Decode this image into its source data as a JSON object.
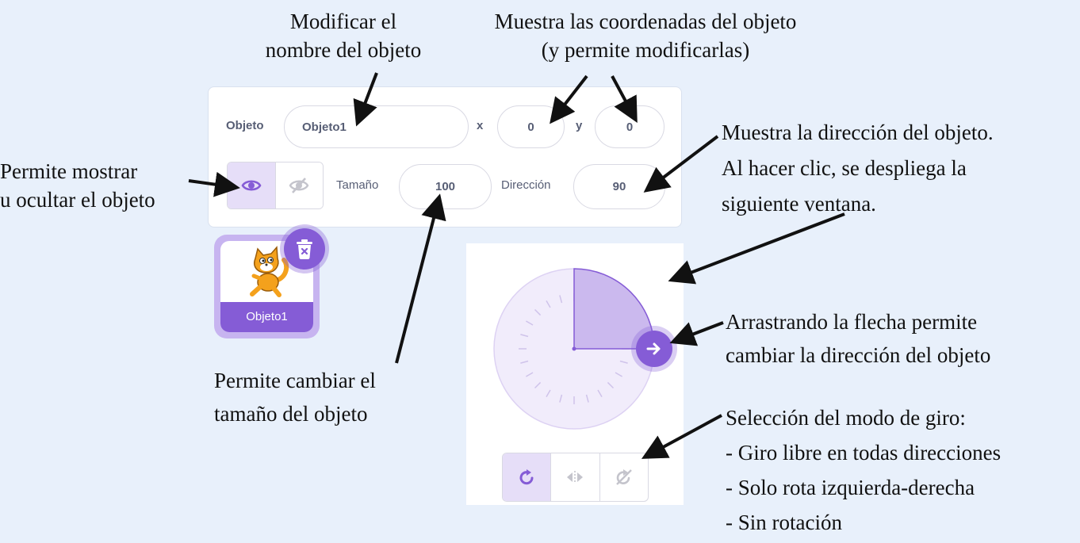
{
  "annotations": {
    "rename": [
      "Modificar el",
      "nombre del objeto"
    ],
    "coords": [
      "Muestra las coordenadas del objeto",
      "(y permite modificarlas)"
    ],
    "visibility": [
      "Permite mostrar",
      "u ocultar el objeto"
    ],
    "direction": [
      "Muestra la dirección del objeto.",
      "Al hacer clic, se despliega la",
      "siguiente ventana."
    ],
    "drag_arrow": [
      "Arrastrando la flecha permite",
      "cambiar la dirección del objeto"
    ],
    "size": [
      "Permite cambiar el",
      "tamaño del objeto"
    ],
    "rotation_mode": [
      "Selección del modo de giro:",
      "- Giro libre en todas direcciones",
      "- Solo rota izquierda-derecha",
      "- Sin rotación"
    ]
  },
  "panel": {
    "sprite_label": "Objeto",
    "sprite_name": "Objeto1",
    "x_label": "x",
    "x_value": "0",
    "y_label": "y",
    "y_value": "0",
    "size_label": "Tamaño",
    "size_value": "100",
    "direction_label": "Dirección",
    "direction_value": "90",
    "show_state": "visible"
  },
  "sprite_tile": {
    "name": "Objeto1",
    "thumbnail_icon": "cat-sprite-icon",
    "delete_icon": "trash-icon"
  },
  "direction_dial": {
    "direction_degrees": 90,
    "handle_icon": "arrow-right-icon",
    "rotation_modes": [
      "all-around-icon",
      "left-right-icon",
      "dont-rotate-icon"
    ],
    "selected_mode": "all-around-icon"
  },
  "colors": {
    "accent": "#855cd6",
    "accent_light": "#e6def8",
    "text": "#575e75",
    "background": "#e8f0fb"
  }
}
